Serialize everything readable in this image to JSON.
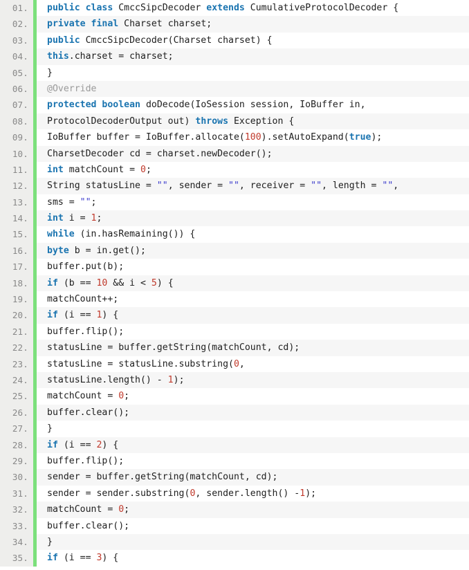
{
  "viewer": {
    "language": "java",
    "gutter_suffix": ".",
    "colors": {
      "keyword": "#1a74b0",
      "number": "#c0392b",
      "string": "#3b3bcc",
      "annotation": "#9a9a9a",
      "plain": "#202020",
      "marker_bar": "#7ce07c",
      "gutter_bg": "#eeeeec",
      "row_odd_bg": "#ffffff",
      "row_even_bg": "#f6f6f6"
    }
  },
  "lines": [
    {
      "no": "01.",
      "tokens": [
        {
          "t": "public",
          "c": "kw"
        },
        {
          "t": " ",
          "c": "pln"
        },
        {
          "t": "class",
          "c": "kw"
        },
        {
          "t": " CmccSipcDecoder ",
          "c": "pln"
        },
        {
          "t": "extends",
          "c": "kw"
        },
        {
          "t": " CumulativeProtocolDecoder {",
          "c": "pln"
        }
      ]
    },
    {
      "no": "02.",
      "tokens": [
        {
          "t": "private",
          "c": "kw"
        },
        {
          "t": " ",
          "c": "pln"
        },
        {
          "t": "final",
          "c": "kw"
        },
        {
          "t": " Charset charset;",
          "c": "pln"
        }
      ]
    },
    {
      "no": "03.",
      "tokens": [
        {
          "t": "public",
          "c": "kw"
        },
        {
          "t": " CmccSipcDecoder(Charset charset) {",
          "c": "pln"
        }
      ]
    },
    {
      "no": "04.",
      "tokens": [
        {
          "t": "this",
          "c": "kw"
        },
        {
          "t": ".charset = charset;",
          "c": "pln"
        }
      ]
    },
    {
      "no": "05.",
      "tokens": [
        {
          "t": "}",
          "c": "pln"
        }
      ]
    },
    {
      "no": "06.",
      "tokens": [
        {
          "t": "@Override",
          "c": "ann"
        }
      ]
    },
    {
      "no": "07.",
      "tokens": [
        {
          "t": "protected",
          "c": "kw"
        },
        {
          "t": " ",
          "c": "pln"
        },
        {
          "t": "boolean",
          "c": "kw"
        },
        {
          "t": " doDecode(IoSession session, IoBuffer in,",
          "c": "pln"
        }
      ]
    },
    {
      "no": "08.",
      "tokens": [
        {
          "t": "ProtocolDecoderOutput out) ",
          "c": "pln"
        },
        {
          "t": "throws",
          "c": "kw"
        },
        {
          "t": " Exception {",
          "c": "pln"
        }
      ]
    },
    {
      "no": "09.",
      "tokens": [
        {
          "t": "IoBuffer buffer = IoBuffer.allocate(",
          "c": "pln"
        },
        {
          "t": "100",
          "c": "num"
        },
        {
          "t": ").setAutoExpand(",
          "c": "pln"
        },
        {
          "t": "true",
          "c": "kw"
        },
        {
          "t": ");",
          "c": "pln"
        }
      ]
    },
    {
      "no": "10.",
      "tokens": [
        {
          "t": "CharsetDecoder cd = charset.newDecoder();",
          "c": "pln"
        }
      ]
    },
    {
      "no": "11.",
      "tokens": [
        {
          "t": "int",
          "c": "kw"
        },
        {
          "t": " matchCount = ",
          "c": "pln"
        },
        {
          "t": "0",
          "c": "num"
        },
        {
          "t": ";",
          "c": "pln"
        }
      ]
    },
    {
      "no": "12.",
      "tokens": [
        {
          "t": "String statusLine = ",
          "c": "pln"
        },
        {
          "t": "\"\"",
          "c": "str"
        },
        {
          "t": ", sender = ",
          "c": "pln"
        },
        {
          "t": "\"\"",
          "c": "str"
        },
        {
          "t": ", receiver = ",
          "c": "pln"
        },
        {
          "t": "\"\"",
          "c": "str"
        },
        {
          "t": ", length = ",
          "c": "pln"
        },
        {
          "t": "\"\"",
          "c": "str"
        },
        {
          "t": ",",
          "c": "pln"
        }
      ]
    },
    {
      "no": "13.",
      "tokens": [
        {
          "t": "sms = ",
          "c": "pln"
        },
        {
          "t": "\"\"",
          "c": "str"
        },
        {
          "t": ";",
          "c": "pln"
        }
      ]
    },
    {
      "no": "14.",
      "tokens": [
        {
          "t": "int",
          "c": "kw"
        },
        {
          "t": " i = ",
          "c": "pln"
        },
        {
          "t": "1",
          "c": "num"
        },
        {
          "t": ";",
          "c": "pln"
        }
      ]
    },
    {
      "no": "15.",
      "tokens": [
        {
          "t": "while",
          "c": "kw"
        },
        {
          "t": " (in.hasRemaining()) {",
          "c": "pln"
        }
      ]
    },
    {
      "no": "16.",
      "tokens": [
        {
          "t": "byte",
          "c": "kw"
        },
        {
          "t": " b = in.get();",
          "c": "pln"
        }
      ]
    },
    {
      "no": "17.",
      "tokens": [
        {
          "t": "buffer.put(b);",
          "c": "pln"
        }
      ]
    },
    {
      "no": "18.",
      "tokens": [
        {
          "t": "if",
          "c": "kw"
        },
        {
          "t": " (b == ",
          "c": "pln"
        },
        {
          "t": "10",
          "c": "num"
        },
        {
          "t": " && i < ",
          "c": "pln"
        },
        {
          "t": "5",
          "c": "num"
        },
        {
          "t": ") {",
          "c": "pln"
        }
      ]
    },
    {
      "no": "19.",
      "tokens": [
        {
          "t": "matchCount++;",
          "c": "pln"
        }
      ]
    },
    {
      "no": "20.",
      "tokens": [
        {
          "t": "if",
          "c": "kw"
        },
        {
          "t": " (i == ",
          "c": "pln"
        },
        {
          "t": "1",
          "c": "num"
        },
        {
          "t": ") {",
          "c": "pln"
        }
      ]
    },
    {
      "no": "21.",
      "tokens": [
        {
          "t": "buffer.flip();",
          "c": "pln"
        }
      ]
    },
    {
      "no": "22.",
      "tokens": [
        {
          "t": "statusLine = buffer.getString(matchCount, cd);",
          "c": "pln"
        }
      ]
    },
    {
      "no": "23.",
      "tokens": [
        {
          "t": "statusLine = statusLine.substring(",
          "c": "pln"
        },
        {
          "t": "0",
          "c": "num"
        },
        {
          "t": ",",
          "c": "pln"
        }
      ]
    },
    {
      "no": "24.",
      "tokens": [
        {
          "t": "statusLine.length() - ",
          "c": "pln"
        },
        {
          "t": "1",
          "c": "num"
        },
        {
          "t": ");",
          "c": "pln"
        }
      ]
    },
    {
      "no": "25.",
      "tokens": [
        {
          "t": "matchCount = ",
          "c": "pln"
        },
        {
          "t": "0",
          "c": "num"
        },
        {
          "t": ";",
          "c": "pln"
        }
      ]
    },
    {
      "no": "26.",
      "tokens": [
        {
          "t": "buffer.clear();",
          "c": "pln"
        }
      ]
    },
    {
      "no": "27.",
      "tokens": [
        {
          "t": "}",
          "c": "pln"
        }
      ]
    },
    {
      "no": "28.",
      "tokens": [
        {
          "t": "if",
          "c": "kw"
        },
        {
          "t": " (i == ",
          "c": "pln"
        },
        {
          "t": "2",
          "c": "num"
        },
        {
          "t": ") {",
          "c": "pln"
        }
      ]
    },
    {
      "no": "29.",
      "tokens": [
        {
          "t": "buffer.flip();",
          "c": "pln"
        }
      ]
    },
    {
      "no": "30.",
      "tokens": [
        {
          "t": "sender = buffer.getString(matchCount, cd);",
          "c": "pln"
        }
      ]
    },
    {
      "no": "31.",
      "tokens": [
        {
          "t": "sender = sender.substring(",
          "c": "pln"
        },
        {
          "t": "0",
          "c": "num"
        },
        {
          "t": ", sender.length() -",
          "c": "pln"
        },
        {
          "t": "1",
          "c": "num"
        },
        {
          "t": ");",
          "c": "pln"
        }
      ]
    },
    {
      "no": "32.",
      "tokens": [
        {
          "t": "matchCount = ",
          "c": "pln"
        },
        {
          "t": "0",
          "c": "num"
        },
        {
          "t": ";",
          "c": "pln"
        }
      ]
    },
    {
      "no": "33.",
      "tokens": [
        {
          "t": "buffer.clear();",
          "c": "pln"
        }
      ]
    },
    {
      "no": "34.",
      "tokens": [
        {
          "t": "}",
          "c": "pln"
        }
      ]
    },
    {
      "no": "35.",
      "tokens": [
        {
          "t": "if",
          "c": "kw"
        },
        {
          "t": " (i == ",
          "c": "pln"
        },
        {
          "t": "3",
          "c": "num"
        },
        {
          "t": ") {",
          "c": "pln"
        }
      ]
    }
  ]
}
